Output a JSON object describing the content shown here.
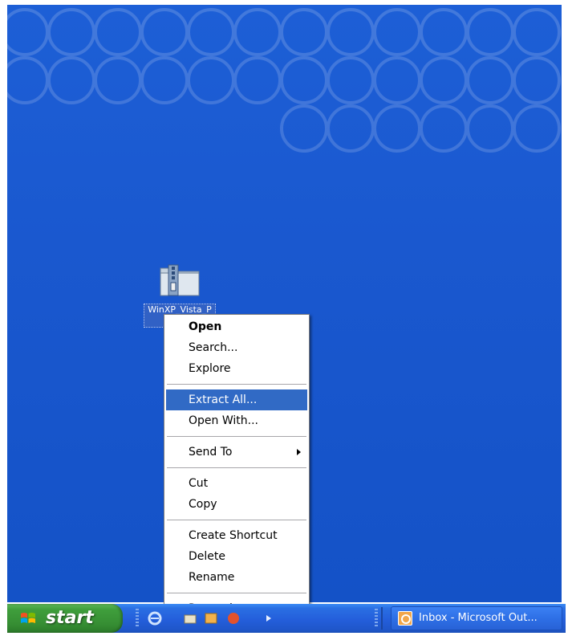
{
  "desktop": {
    "icon_label": "WinXP_Vista_P\nro Se"
  },
  "context_menu": {
    "items": [
      {
        "label": "Open",
        "default": true
      },
      {
        "label": "Search..."
      },
      {
        "label": "Explore"
      },
      {
        "label": "Extract All...",
        "highlighted": true
      },
      {
        "label": "Open With..."
      },
      {
        "label": "Send To",
        "submenu": true
      },
      {
        "label": "Cut"
      },
      {
        "label": "Copy"
      },
      {
        "label": "Create Shortcut"
      },
      {
        "label": "Delete"
      },
      {
        "label": "Rename"
      },
      {
        "label": "Properties"
      }
    ]
  },
  "taskbar": {
    "start_label": "start",
    "task_button_label": "Inbox - Microsoft Out..."
  },
  "colors": {
    "desktop": "#1a58cf",
    "highlight": "#316ac5",
    "start_button": "#3f9e3c"
  },
  "icons": {
    "desktop_icon": "zip-folder-icon",
    "task_button_icon": "outlook-icon",
    "submenu_arrow": "triangle-right-icon"
  }
}
